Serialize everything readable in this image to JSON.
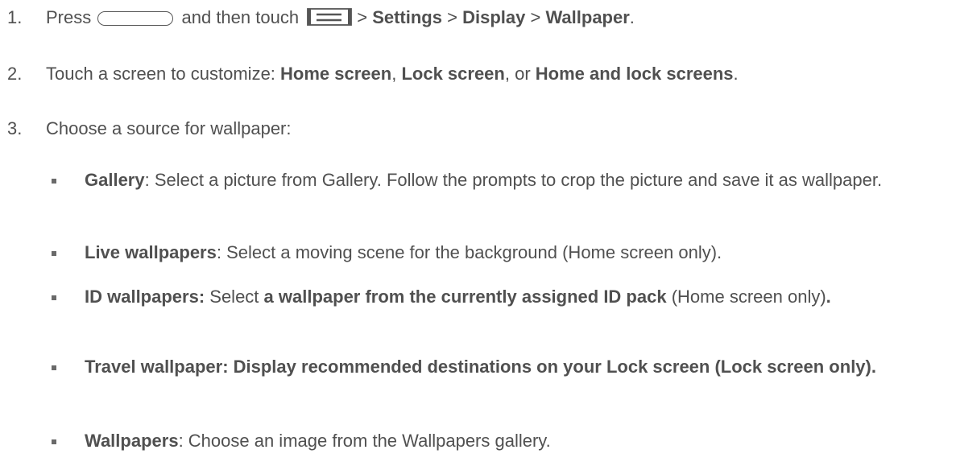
{
  "steps": [
    {
      "number": "1.",
      "press": "Press",
      "and_then_touch": "and then touch",
      "sep1": ">",
      "settings": "Settings",
      "sep2": ">",
      "display": "Display",
      "sep3": ">",
      "wallpaper": "Wallpaper",
      "period": "."
    },
    {
      "number": "2.",
      "intro": "Touch a screen to customize: ",
      "home_screen": "Home screen",
      "comma1": ", ",
      "lock_screen": "Lock screen",
      "or": ", or ",
      "home_and_lock": "Home and lock screens",
      "period": "."
    },
    {
      "number": "3.",
      "text": "Choose a source for wallpaper:"
    }
  ],
  "sources": [
    {
      "title": "Gallery",
      "rest": ": Select a picture from Gallery. Follow the prompts to crop the picture and save it as wallpaper."
    },
    {
      "title": "Live wallpapers",
      "rest": ": Select a moving scene for the background (Home screen only)."
    },
    {
      "title": "ID wallpapers:",
      "mid": " Select ",
      "bold2": "a wallpaper from the currently assigned ID pack",
      "rest": " (Home screen only)",
      "end": "."
    },
    {
      "title": "Travel wallpaper: Display recommended destinations on your Lock screen (Lock screen only)."
    },
    {
      "title": "Wallpapers",
      "rest": ": Choose an image from the Wallpapers gallery."
    }
  ],
  "icons": {
    "home_key": "home-key-icon",
    "menu_key": "menu-key-icon"
  }
}
